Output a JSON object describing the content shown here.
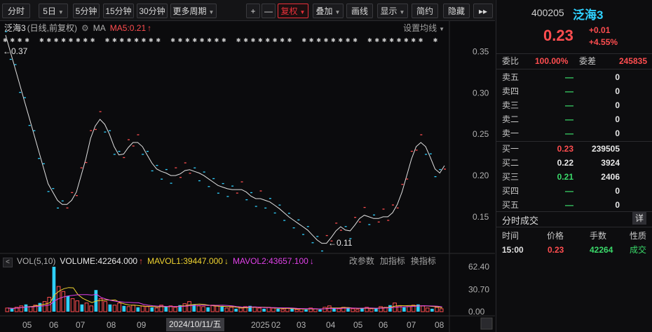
{
  "toolbar": {
    "items": [
      "分时",
      "5日",
      "5分钟",
      "15分钟",
      "30分钟",
      "更多周期",
      "+",
      "—",
      "复权",
      "叠加",
      "画线",
      "显示",
      "简约",
      "隐藏",
      "▸▸"
    ]
  },
  "legend": {
    "name": "泛海3",
    "mode": "(日线,前复权)",
    "ma_label": "MA",
    "ma5": "MA5:0.21",
    "ma5_arrow": "↑",
    "setting": "设置均线"
  },
  "vol_legend": {
    "label": "VOL(5,10)",
    "volume": "VOLUME:42264.000",
    "volume_arrow": "↑",
    "mavol1": "MAVOL1:39447.000",
    "mavol1_arrow": "↓",
    "mavol2": "MAVOL2:43657.100",
    "mavol2_arrow": "↓",
    "btn1": "改参数",
    "btn2": "加指标",
    "btn3": "换指标"
  },
  "date_tag": "2024/10/11/五",
  "annotations": {
    "high": "←0.37",
    "low": "←0.11"
  },
  "chart_data": [
    {
      "type": "line",
      "title": "泛海3 (日线,前复权)",
      "y_ticks": [
        "0.35",
        "0.30",
        "0.25",
        "0.20",
        "0.15"
      ],
      "y_range": [
        0.11,
        0.37
      ],
      "x_ticks": [
        "05",
        "06",
        "07",
        "08",
        "09",
        "2024/10/11/五",
        "2025",
        "02",
        "03",
        "04",
        "05",
        "06",
        "07",
        "08"
      ],
      "series": [
        {
          "name": "MA5",
          "values": [
            0.37,
            0.35,
            0.33,
            0.31,
            0.29,
            0.27,
            0.25,
            0.23,
            0.21,
            0.19,
            0.18,
            0.17,
            0.165,
            0.165,
            0.17,
            0.18,
            0.2,
            0.22,
            0.245,
            0.26,
            0.268,
            0.262,
            0.25,
            0.235,
            0.225,
            0.226,
            0.234,
            0.24,
            0.24,
            0.235,
            0.225,
            0.215,
            0.208,
            0.205,
            0.203,
            0.2,
            0.2,
            0.202,
            0.206,
            0.207,
            0.205,
            0.203,
            0.2,
            0.196,
            0.192,
            0.188,
            0.186,
            0.184,
            0.183,
            0.183,
            0.183,
            0.18,
            0.175,
            0.172,
            0.172,
            0.17,
            0.168,
            0.164,
            0.16,
            0.155,
            0.15,
            0.146,
            0.142,
            0.138,
            0.134,
            0.128,
            0.122,
            0.118,
            0.118,
            0.125,
            0.133,
            0.138,
            0.134,
            0.133,
            0.14,
            0.148,
            0.152,
            0.15,
            0.148,
            0.148,
            0.15,
            0.15,
            0.155,
            0.165,
            0.18,
            0.2,
            0.22,
            0.235,
            0.24,
            0.235,
            0.222,
            0.208,
            0.203,
            0.212
          ]
        }
      ]
    },
    {
      "type": "bar",
      "title": "VOL(5,10)",
      "y_ticks": [
        "62.40",
        "30.70",
        "0.00"
      ],
      "y_range": [
        0,
        62.4
      ],
      "values": [
        5,
        4,
        6,
        8,
        10,
        7,
        9,
        12,
        14,
        20,
        62.4,
        35,
        28,
        22,
        18,
        15,
        10,
        12,
        8,
        30,
        18,
        14,
        10,
        9,
        12,
        8,
        7,
        9,
        6,
        8,
        7,
        6,
        5,
        9,
        7,
        8,
        6,
        9,
        11,
        14,
        10,
        8,
        7,
        6,
        9,
        8,
        7,
        5,
        6,
        4,
        5,
        7,
        8,
        6,
        5,
        4,
        6,
        5,
        4,
        3,
        5,
        4,
        3,
        4,
        3,
        5,
        4,
        3,
        6,
        8,
        5,
        4,
        6,
        5,
        4,
        3,
        5,
        6,
        4,
        5,
        7,
        6,
        9,
        12,
        8,
        6,
        7,
        9,
        10,
        8,
        5,
        4,
        6,
        4
      ],
      "series": [
        {
          "name": "MAVOL1",
          "color": "#f0d430"
        },
        {
          "name": "MAVOL2",
          "color": "#e040e8"
        }
      ]
    }
  ],
  "colors": {
    "up": "#ff4d4f",
    "down": "#2fd1ff",
    "ma5": "#e0e0e0",
    "mavol1": "#f0d430",
    "mavol2": "#e040e8",
    "accent": "#e8303a"
  },
  "quote": {
    "code": "400205",
    "name": "泛海3",
    "price": "0.23",
    "change": "+0.01",
    "pct": "+4.55%",
    "weibi_label": "委比",
    "weibi": "100.00%",
    "weicha_label": "委差",
    "weicha": "245835"
  },
  "sells": [
    {
      "label": "卖五",
      "price": "—",
      "vol": "0"
    },
    {
      "label": "卖四",
      "price": "—",
      "vol": "0"
    },
    {
      "label": "卖三",
      "price": "—",
      "vol": "0"
    },
    {
      "label": "卖二",
      "price": "—",
      "vol": "0"
    },
    {
      "label": "卖一",
      "price": "—",
      "vol": "0"
    }
  ],
  "buys": [
    {
      "label": "买一",
      "price": "0.23",
      "vol": "239505",
      "color": "#ff4d4f"
    },
    {
      "label": "买二",
      "price": "0.22",
      "vol": "3924",
      "color": "#e8e8e8"
    },
    {
      "label": "买三",
      "price": "0.21",
      "vol": "2406",
      "color": "#3ad96a"
    },
    {
      "label": "买四",
      "price": "—",
      "vol": "0",
      "color": "#3ad96a"
    },
    {
      "label": "买五",
      "price": "—",
      "vol": "0",
      "color": "#3ad96a"
    }
  ],
  "trades": {
    "title": "分时成交",
    "detail": "详",
    "headers": [
      "时间",
      "价格",
      "手数",
      "性质"
    ],
    "rows": [
      {
        "time": "15:00",
        "price": "0.23",
        "vol": "42264",
        "type": "成交"
      }
    ]
  }
}
